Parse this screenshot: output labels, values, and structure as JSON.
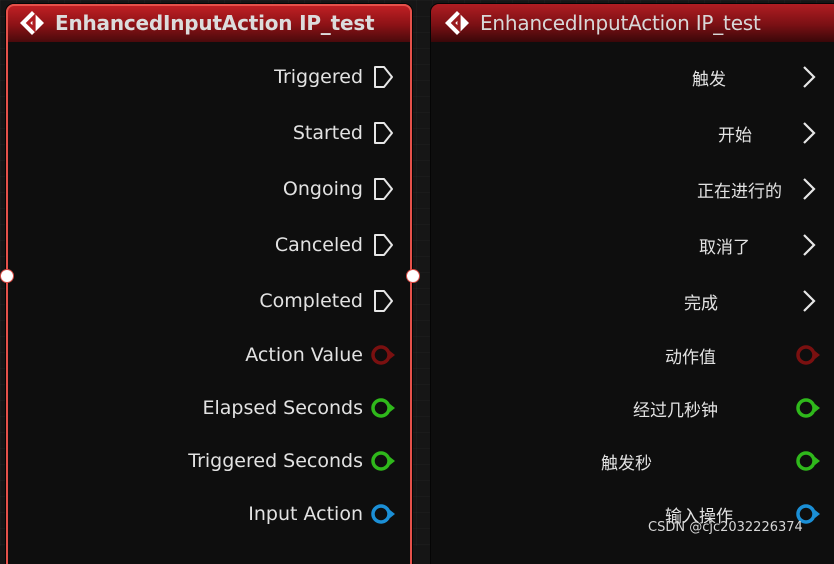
{
  "left_node": {
    "title": "EnhancedInputAction IP_test",
    "icon": "enhanced-input-diamond-icon",
    "outline_color": "#e5514a",
    "pins": [
      {
        "label": "Triggered",
        "type": "exec"
      },
      {
        "label": "Started",
        "type": "exec"
      },
      {
        "label": "Ongoing",
        "type": "exec"
      },
      {
        "label": "Canceled",
        "type": "exec"
      },
      {
        "label": "Completed",
        "type": "exec"
      },
      {
        "label": "Action Value",
        "type": "data",
        "color": "#7a1010"
      },
      {
        "label": "Elapsed Seconds",
        "type": "data",
        "color": "#2fb81b"
      },
      {
        "label": "Triggered Seconds",
        "type": "data",
        "color": "#2fb81b"
      },
      {
        "label": "Input Action",
        "type": "data",
        "color": "#1b8fd6"
      }
    ]
  },
  "right_node": {
    "title": "EnhancedInputAction IP_test",
    "icon": "enhanced-input-diamond-icon",
    "pins": [
      {
        "label": "触发",
        "type": "exec"
      },
      {
        "label": "开始",
        "type": "exec"
      },
      {
        "label": "正在进行的",
        "type": "exec"
      },
      {
        "label": "取消了",
        "type": "exec"
      },
      {
        "label": "完成",
        "type": "exec"
      },
      {
        "label": "动作值",
        "type": "data",
        "color": "#7a1010"
      },
      {
        "label": "经过几秒钟",
        "type": "data",
        "color": "#2fb81b"
      },
      {
        "label": "触发秒",
        "type": "data",
        "color": "#2fb81b"
      },
      {
        "label": "输入操作",
        "type": "data",
        "color": "#1b8fd6"
      }
    ]
  },
  "watermark": "CSDN @cjc2032226374"
}
